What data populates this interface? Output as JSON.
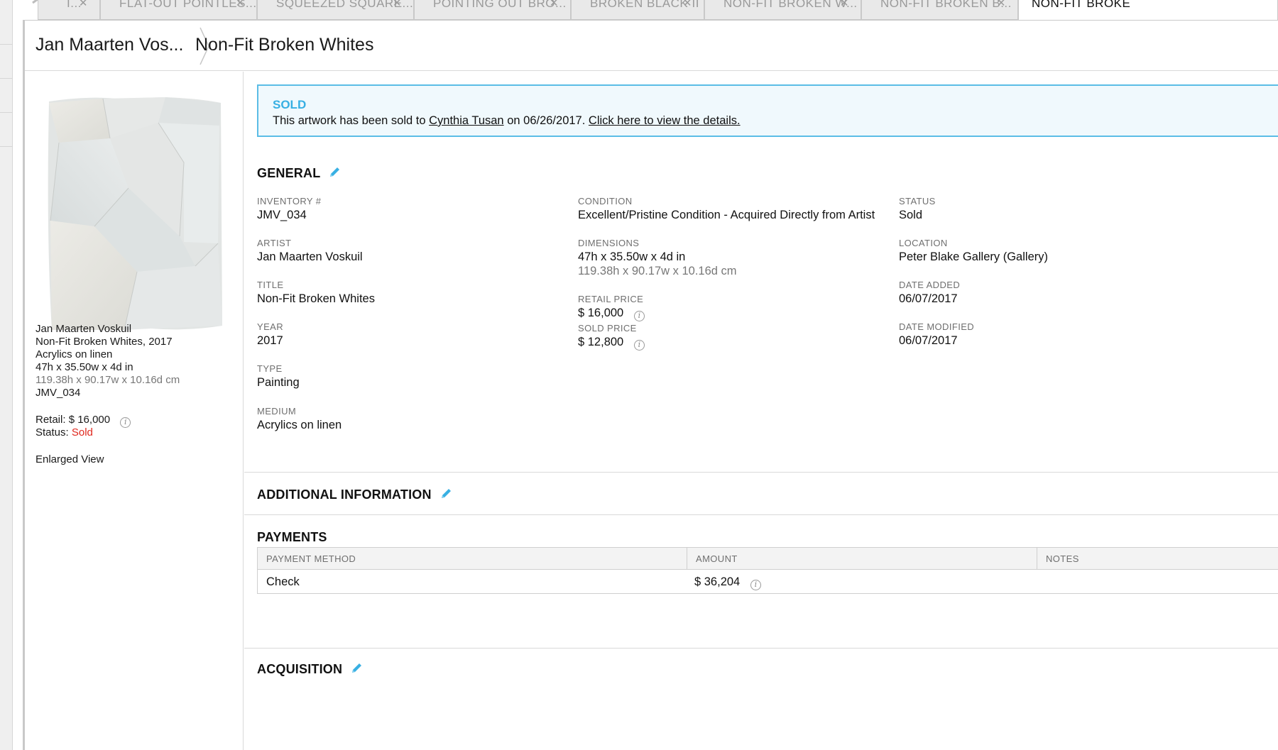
{
  "tabs": [
    {
      "label": "I...",
      "active": false
    },
    {
      "label": "FLAT-OUT POINTLES...",
      "active": false
    },
    {
      "label": "SQUEEZED SQUARE...",
      "active": false
    },
    {
      "label": "POINTING OUT BRO...",
      "active": false
    },
    {
      "label": "BROKEN BLACK II",
      "active": false
    },
    {
      "label": "NON-FIT BROKEN W...",
      "active": false
    },
    {
      "label": "NON-FIT BROKEN B...",
      "active": false
    },
    {
      "label": "NON-FIT BROKE",
      "active": true
    }
  ],
  "breadcrumb": {
    "parent": "Jan Maarten Vos...",
    "current": "Non-Fit Broken Whites"
  },
  "sidebar": {
    "artist": "Jan Maarten Voskuil",
    "title_year": "Non-Fit Broken Whites, 2017",
    "medium": "Acrylics on linen",
    "dimensions_in": "47h x 35.50w x 4d in",
    "dimensions_cm": "119.38h x 90.17w x 10.16d cm",
    "inventory": "JMV_034",
    "retail_label": "Retail:",
    "retail_value": "$ 16,000",
    "status_label": "Status:",
    "status_value": "Sold",
    "enlarged_view": "Enlarged View"
  },
  "sold_banner": {
    "title": "SOLD",
    "msg_prefix": "This artwork has been sold to",
    "buyer": "Cynthia Tusan",
    "msg_mid": "on 06/26/2017.",
    "details_link": "Click here to view the details."
  },
  "general": {
    "title": "GENERAL",
    "fields": {
      "inventory": {
        "label": "INVENTORY #",
        "value": "JMV_034"
      },
      "artist": {
        "label": "ARTIST",
        "value": "Jan Maarten Voskuil"
      },
      "title": {
        "label": "TITLE",
        "value": "Non-Fit Broken Whites"
      },
      "year": {
        "label": "YEAR",
        "value": "2017"
      },
      "type": {
        "label": "TYPE",
        "value": "Painting"
      },
      "medium": {
        "label": "MEDIUM",
        "value": "Acrylics on linen"
      },
      "condition": {
        "label": "CONDITION",
        "value": "Excellent/Pristine Condition - Acquired Directly from Artist"
      },
      "dimensions": {
        "label": "DIMENSIONS",
        "value": "47h x 35.50w x 4d in",
        "value_cm": "119.38h x 90.17w x 10.16d cm"
      },
      "retail_price": {
        "label": "RETAIL PRICE",
        "value": "$ 16,000"
      },
      "sold_price": {
        "label": "SOLD PRICE",
        "value": "$ 12,800"
      },
      "status": {
        "label": "STATUS",
        "value": "Sold"
      },
      "location": {
        "label": "LOCATION",
        "value": "Peter Blake Gallery (Gallery)"
      },
      "date_added": {
        "label": "DATE ADDED",
        "value": "06/07/2017"
      },
      "date_modified": {
        "label": "DATE MODIFIED",
        "value": "06/07/2017"
      }
    }
  },
  "additional_info": {
    "title": "ADDITIONAL INFORMATION"
  },
  "payments": {
    "title": "PAYMENTS",
    "headers": [
      "PAYMENT METHOD",
      "AMOUNT",
      "NOTES"
    ],
    "rows": [
      {
        "method": "Check",
        "amount": "$ 36,204",
        "notes": ""
      }
    ]
  },
  "acquisition": {
    "title": "ACQUISITION"
  },
  "colors": {
    "accent": "#38b0e3",
    "banner_bg": "#f0f9fd",
    "sold_red": "#e0281e"
  }
}
